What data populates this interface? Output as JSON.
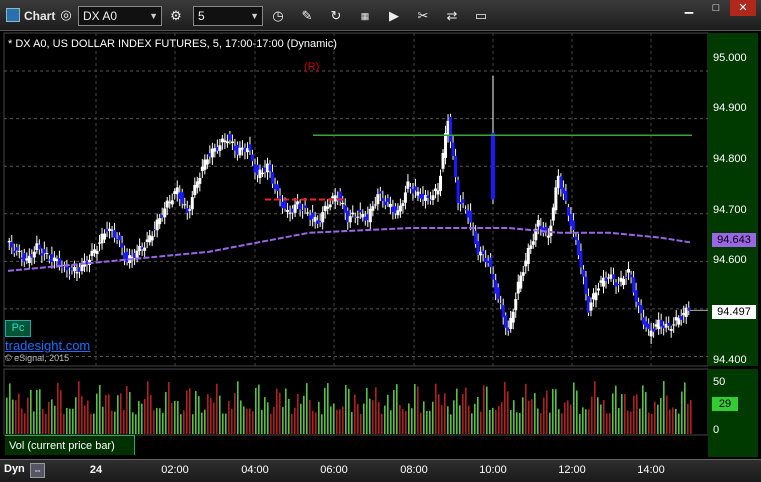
{
  "window": {
    "title": "Chart"
  },
  "toolbar": {
    "symbol": "DX A0",
    "interval": "5",
    "icons": [
      "interval-icon",
      "time-icon",
      "draw-icon",
      "refresh-icon",
      "study-icon",
      "play-icon",
      "tools-icon",
      "chat-icon"
    ]
  },
  "chart": {
    "header": "* DX A0, US DOLLAR INDEX FUTURES, 5, 17:00-17:00 (Dynamic)",
    "badge": "Pc",
    "link": "tradesight.com",
    "copyright": "© eSignal, 2015",
    "annotation": "(R)",
    "price_labels": [
      "95.000",
      "94.900",
      "94.800",
      "94.700",
      "94.600",
      "94.400"
    ],
    "current_price": "94.497",
    "ma_value": "94.643",
    "volume_labels": [
      "50",
      "29",
      "0"
    ],
    "volume_badge": "Vol (current price bar)",
    "time_labels": [
      "24",
      "02:00",
      "04:00",
      "06:00",
      "08:00",
      "10:00",
      "12:00",
      "14:00"
    ],
    "mode": "Dyn"
  },
  "colors": {
    "up": "#ffffff",
    "down": "#1a1aff",
    "ma": "#9a66e6",
    "resistance": "#33aa33",
    "support": "#ee2222",
    "vol_up": "#55c240",
    "vol_down": "#b02020"
  },
  "chart_data": {
    "type": "candlestick",
    "title": "* DX A0, US DOLLAR INDEX FUTURES, 5, 17:00-17:00 (Dynamic)",
    "x": [
      "24",
      "02:00",
      "04:00",
      "06:00",
      "08:00",
      "10:00",
      "12:00",
      "14:00"
    ],
    "ylim": [
      94.38,
      95.08
    ],
    "yticks": [
      95.0,
      94.9,
      94.8,
      94.7,
      94.6,
      94.4
    ],
    "close_path": [
      [
        0,
        94.64
      ],
      [
        1,
        94.62
      ],
      [
        2,
        94.6
      ],
      [
        3,
        94.63
      ],
      [
        4,
        94.61
      ],
      [
        5,
        94.6
      ],
      [
        6,
        94.58
      ],
      [
        7,
        94.58
      ],
      [
        8,
        94.6
      ],
      [
        9,
        94.63
      ],
      [
        10,
        94.67
      ],
      [
        11,
        94.65
      ],
      [
        12,
        94.6
      ],
      [
        13,
        94.62
      ],
      [
        14,
        94.64
      ],
      [
        15,
        94.68
      ],
      [
        16,
        94.72
      ],
      [
        17,
        94.75
      ],
      [
        18,
        94.7
      ],
      [
        19,
        94.77
      ],
      [
        20,
        94.82
      ],
      [
        21,
        94.84
      ],
      [
        22,
        94.86
      ],
      [
        23,
        94.83
      ],
      [
        24,
        94.84
      ],
      [
        25,
        94.78
      ],
      [
        26,
        94.8
      ],
      [
        27,
        94.74
      ],
      [
        28,
        94.7
      ],
      [
        29,
        94.72
      ],
      [
        30,
        94.7
      ],
      [
        31,
        94.68
      ],
      [
        32,
        94.72
      ],
      [
        33,
        94.74
      ],
      [
        34,
        94.69
      ],
      [
        35,
        94.7
      ],
      [
        36,
        94.69
      ],
      [
        37,
        94.74
      ],
      [
        38,
        94.72
      ],
      [
        39,
        94.7
      ],
      [
        40,
        94.76
      ],
      [
        41,
        94.74
      ],
      [
        42,
        94.73
      ],
      [
        43,
        94.75
      ],
      [
        44,
        94.9
      ],
      [
        45,
        94.73
      ],
      [
        46,
        94.7
      ],
      [
        47,
        94.62
      ],
      [
        48,
        94.6
      ],
      [
        49,
        94.52
      ],
      [
        50,
        94.45
      ],
      [
        51,
        94.55
      ],
      [
        52,
        94.62
      ],
      [
        53,
        94.68
      ],
      [
        54,
        94.65
      ],
      [
        55,
        94.78
      ],
      [
        56,
        94.7
      ],
      [
        57,
        94.62
      ],
      [
        58,
        94.5
      ],
      [
        59,
        94.55
      ],
      [
        60,
        94.57
      ],
      [
        61,
        94.55
      ],
      [
        62,
        94.58
      ],
      [
        63,
        94.5
      ],
      [
        64,
        94.45
      ],
      [
        65,
        94.47
      ],
      [
        66,
        94.46
      ],
      [
        67,
        94.48
      ],
      [
        68,
        94.5
      ]
    ],
    "ma_path": [
      [
        0,
        94.58
      ],
      [
        10,
        94.6
      ],
      [
        20,
        94.62
      ],
      [
        30,
        94.66
      ],
      [
        40,
        94.67
      ],
      [
        45,
        94.67
      ],
      [
        50,
        94.67
      ],
      [
        55,
        94.66
      ],
      [
        60,
        94.66
      ],
      [
        65,
        94.65
      ],
      [
        68,
        94.64
      ]
    ],
    "resistance": 94.865,
    "support": 94.73,
    "current_price": 94.497,
    "ma_value": 94.643,
    "volume_ylim": [
      0,
      50
    ],
    "volume_current": 29
  }
}
